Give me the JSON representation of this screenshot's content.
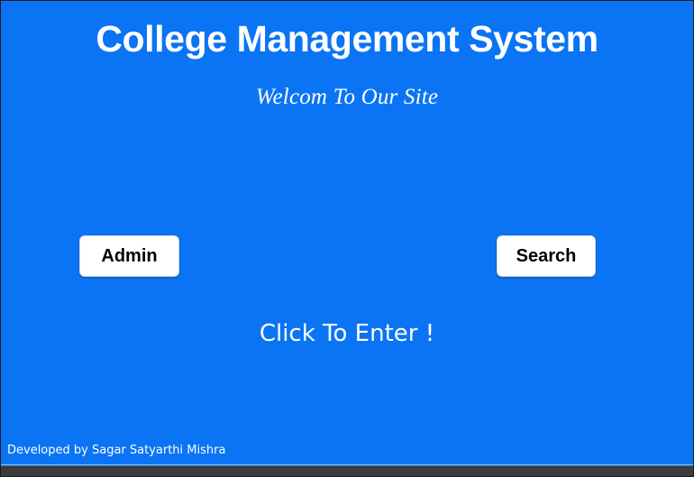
{
  "header": {
    "title": "College Management System",
    "subtitle": "Welcom To Our Site"
  },
  "actions": {
    "admin_label": "Admin",
    "search_label": "Search"
  },
  "main": {
    "enter_text": "Click To Enter !"
  },
  "footer": {
    "credit": "Developed by Sagar Satyarthi Mishra"
  },
  "colors": {
    "background": "#0a74f4",
    "text": "#ffffff",
    "button_bg": "#ffffff",
    "button_text": "#000000"
  }
}
